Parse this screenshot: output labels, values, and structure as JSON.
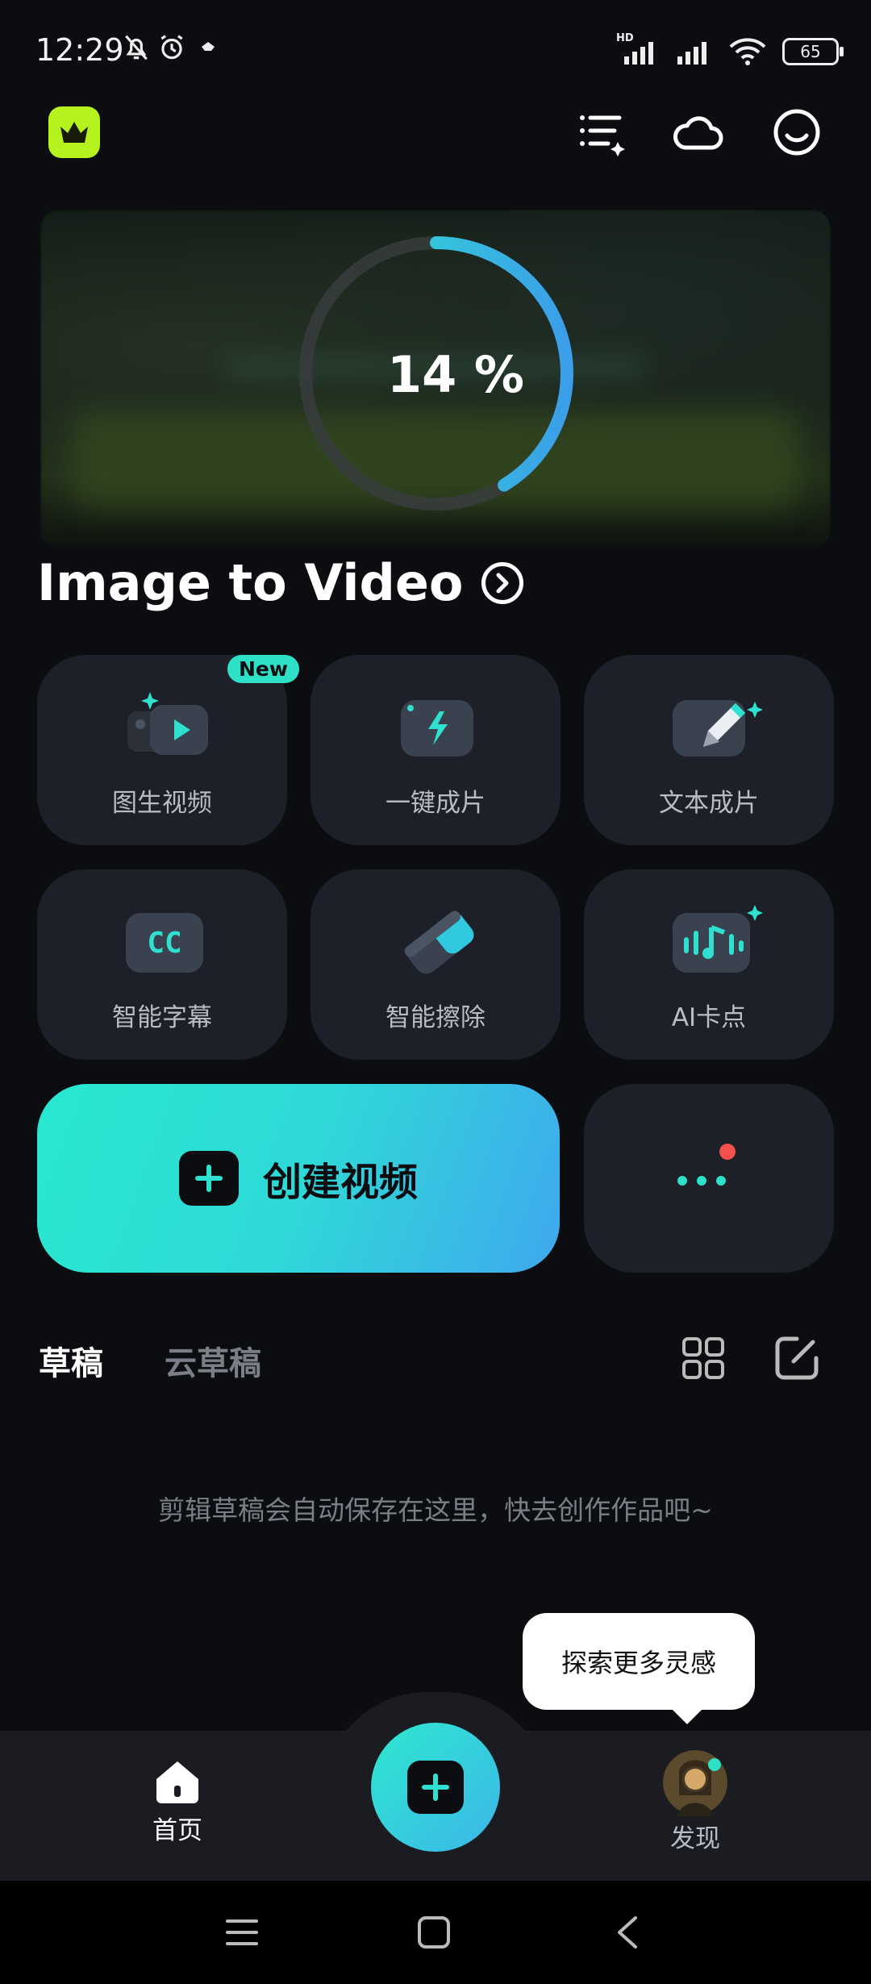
{
  "status_bar": {
    "time": "12:29",
    "battery": "65",
    "network_badge": "HD"
  },
  "header": {
    "vip_icon": "crown-icon",
    "icons": [
      "task-list-icon",
      "cloud-icon",
      "profile-icon"
    ]
  },
  "hero": {
    "progress_percent": 14,
    "progress_text": "14 %"
  },
  "promo": {
    "title": "Image to Video"
  },
  "tools": [
    {
      "label": "图生视频",
      "icon": "image-to-video-icon",
      "badge": "New"
    },
    {
      "label": "一键成片",
      "icon": "one-click-icon"
    },
    {
      "label": "文本成片",
      "icon": "text-to-video-icon"
    },
    {
      "label": "智能字幕",
      "icon": "caption-icon",
      "icon_text": "CC"
    },
    {
      "label": "智能擦除",
      "icon": "eraser-icon"
    },
    {
      "label": "AI卡点",
      "icon": "beat-icon"
    }
  ],
  "create_button": {
    "label": "创建视频"
  },
  "drafts": {
    "tabs": [
      "草稿",
      "云草稿"
    ],
    "empty_message": "剪辑草稿会自动保存在这里，快去创作作品吧~"
  },
  "tooltip": {
    "text": "探索更多灵感"
  },
  "bottom_nav": {
    "home": "首页",
    "discover": "发现"
  },
  "colors": {
    "accent": "#2ee0c6",
    "background": "#0c0d11",
    "tile": "#1d2028",
    "notify_dot": "#f5504e"
  }
}
